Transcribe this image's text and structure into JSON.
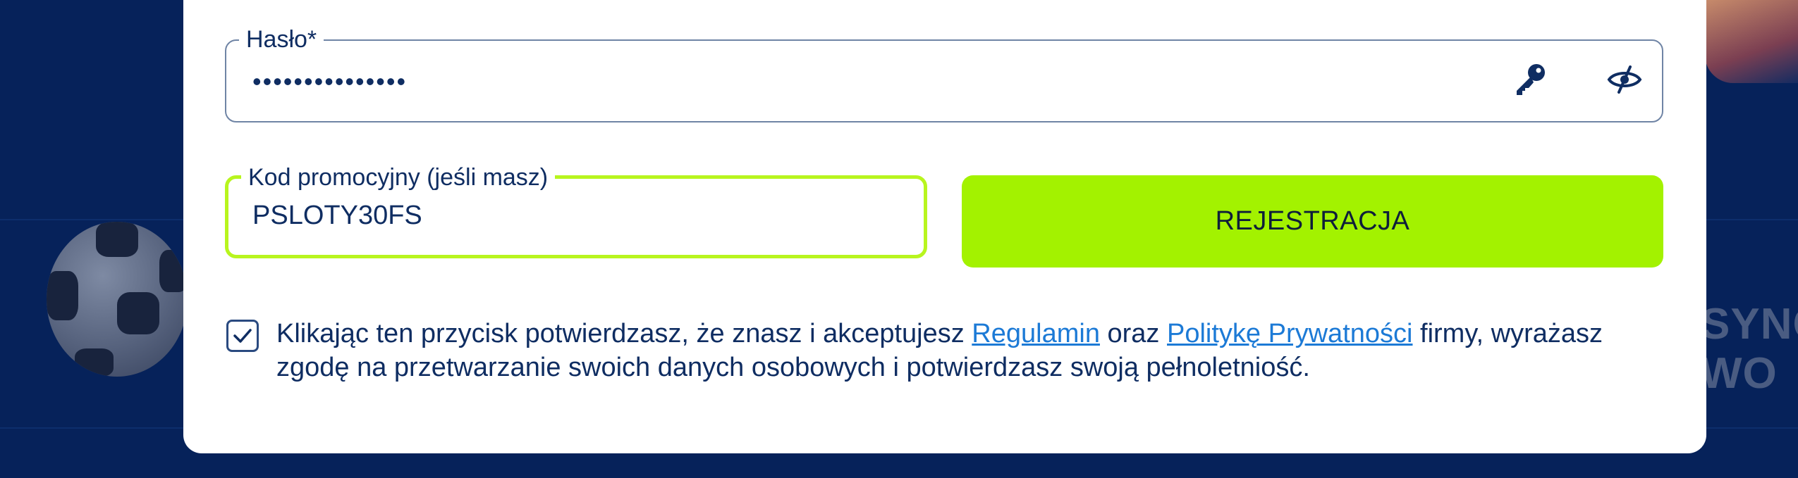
{
  "form": {
    "password": {
      "label": "Hasło*",
      "value": "•••••••••••••••"
    },
    "promo": {
      "label": "Kod promocyjny (jeśli masz)",
      "value": "PSLOTY30FS"
    },
    "register_button": "REJESTRACJA",
    "consent": {
      "checked": true,
      "text_before": "Klikając ten przycisk potwierdzasz, że znasz i akceptujesz ",
      "link_terms": "Regulamin",
      "text_between": " oraz ",
      "link_privacy": "Politykę Prywatności",
      "text_after": " firmy, wyrażasz zgodę na przetwarzanie swoich danych osobowych i potwierdzasz swoją pełnoletniość."
    }
  },
  "background": {
    "right_text_line1": "SYNC",
    "right_text_line2": "WO"
  },
  "colors": {
    "page_background": "#06225a",
    "accent_green": "#a3f200",
    "promo_border": "#b8f51e",
    "text_dark_blue": "#0f2d62",
    "link_blue": "#1c7ad6"
  },
  "icons": {
    "password_generate": "key-icon",
    "password_visibility": "eye-slash-icon",
    "consent_checkbox": "check-icon"
  }
}
